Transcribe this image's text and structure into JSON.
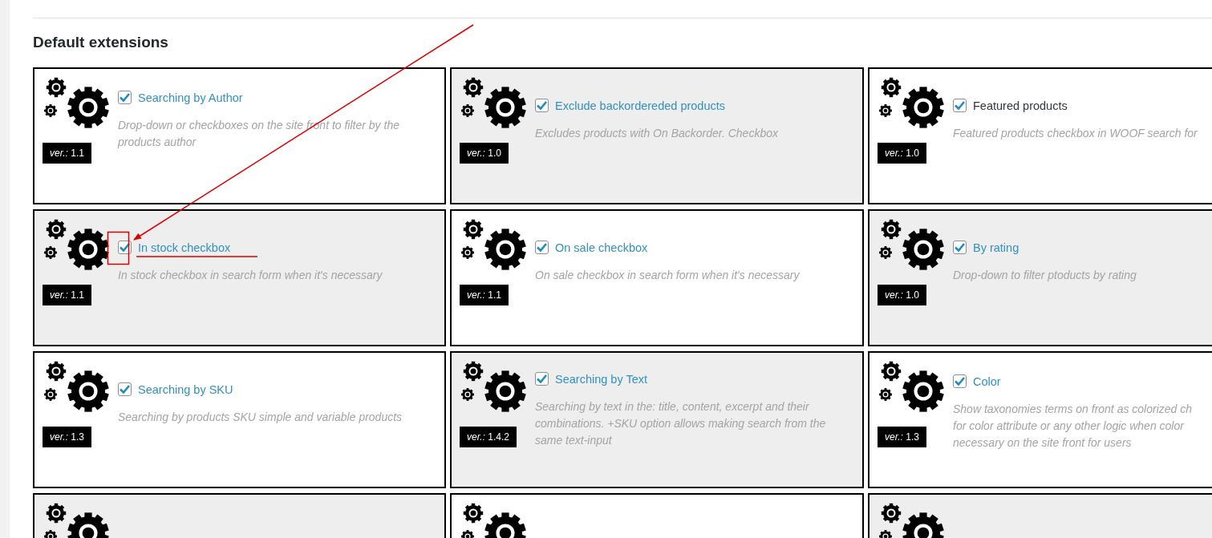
{
  "section": {
    "title": "Default extensions"
  },
  "cards": [
    {
      "title": "Searching by Author",
      "link": true,
      "checked": true,
      "shaded": false,
      "description": "Drop-down or checkboxes on the site front to filter by the products author",
      "version": "*ver.:* 1.1"
    },
    {
      "title": "Exclude backordereded products",
      "link": true,
      "checked": true,
      "shaded": true,
      "description": "Excludes products with On Backorder. Checkbox",
      "version": "*ver.:* 1.0"
    },
    {
      "title": "Featured products",
      "link": false,
      "checked": true,
      "shaded": false,
      "description": "Featured products checkbox in WOOF search for",
      "version": "*ver.:* 1.0"
    },
    {
      "title": "In stock checkbox",
      "link": true,
      "checked": true,
      "shaded": true,
      "description": "In stock checkbox in search form when it's necessary",
      "version": "*ver.:* 1.1"
    },
    {
      "title": "On sale checkbox",
      "link": true,
      "checked": true,
      "shaded": false,
      "description": "On sale checkbox in search form when it's necessary",
      "version": "*ver.:* 1.1"
    },
    {
      "title": "By rating",
      "link": true,
      "checked": true,
      "shaded": true,
      "description": "Drop-down to filter ptoducts by rating",
      "version": "*ver.:* 1.0"
    },
    {
      "title": "Searching by SKU",
      "link": true,
      "checked": true,
      "shaded": false,
      "description": "Searching by products SKU simple and variable products",
      "version": "*ver.:* 1.3"
    },
    {
      "title": "Searching by Text",
      "link": true,
      "checked": true,
      "shaded": true,
      "description": "Searching by text in the: title, content, excerpt and their combinations. +SKU option allows making search from the same text-input",
      "version": "*ver.:* 1.4.2"
    },
    {
      "title": "Color",
      "link": true,
      "checked": true,
      "shaded": false,
      "description": "Show taxonomies terms on front as colorized ch for color attribute or any other logic when color necessary on the site front for users",
      "version": "*ver.:* 1.3"
    },
    {
      "shaded": true
    },
    {
      "shaded": false
    },
    {
      "shaded": true
    }
  ]
}
